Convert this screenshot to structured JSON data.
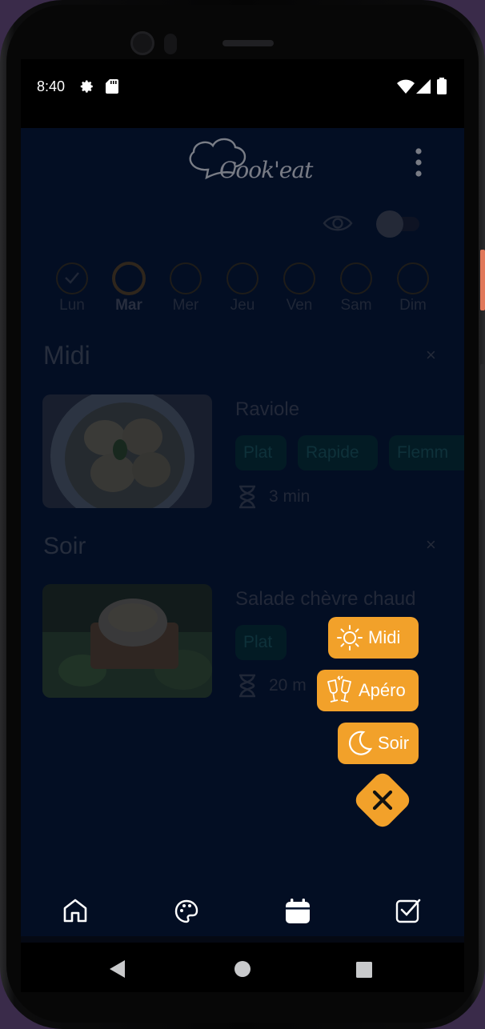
{
  "status": {
    "time": "8:40"
  },
  "app": {
    "logo_text": "Cook'eat"
  },
  "days": [
    {
      "label": "Lun",
      "done": true,
      "active": false
    },
    {
      "label": "Mar",
      "done": false,
      "active": true
    },
    {
      "label": "Mer",
      "done": false,
      "active": false
    },
    {
      "label": "Jeu",
      "done": false,
      "active": false
    },
    {
      "label": "Ven",
      "done": false,
      "active": false
    },
    {
      "label": "Sam",
      "done": false,
      "active": false
    },
    {
      "label": "Dim",
      "done": false,
      "active": false
    }
  ],
  "sections": [
    {
      "title": "Midi",
      "close": "×",
      "meal": {
        "name": "Raviole",
        "tags": [
          "Plat",
          "Rapide",
          "Flemm"
        ],
        "time": "3 min"
      }
    },
    {
      "title": "Soir",
      "close": "×",
      "meal": {
        "name": "Salade chèvre chaud",
        "tags": [
          "Plat"
        ],
        "time": "20 m"
      }
    }
  ],
  "fab_menu": {
    "midi": "Midi",
    "apero": "Apéro",
    "soir": "Soir"
  },
  "colors": {
    "accent": "#f2a12a",
    "background": "#071732",
    "chip": "#073135"
  },
  "icons": {
    "nav": [
      "home-icon",
      "palette-icon",
      "calendar-icon",
      "checkbox-icon"
    ],
    "fab": [
      "sun-icon",
      "cheers-icon",
      "moon-icon",
      "close-icon"
    ]
  }
}
